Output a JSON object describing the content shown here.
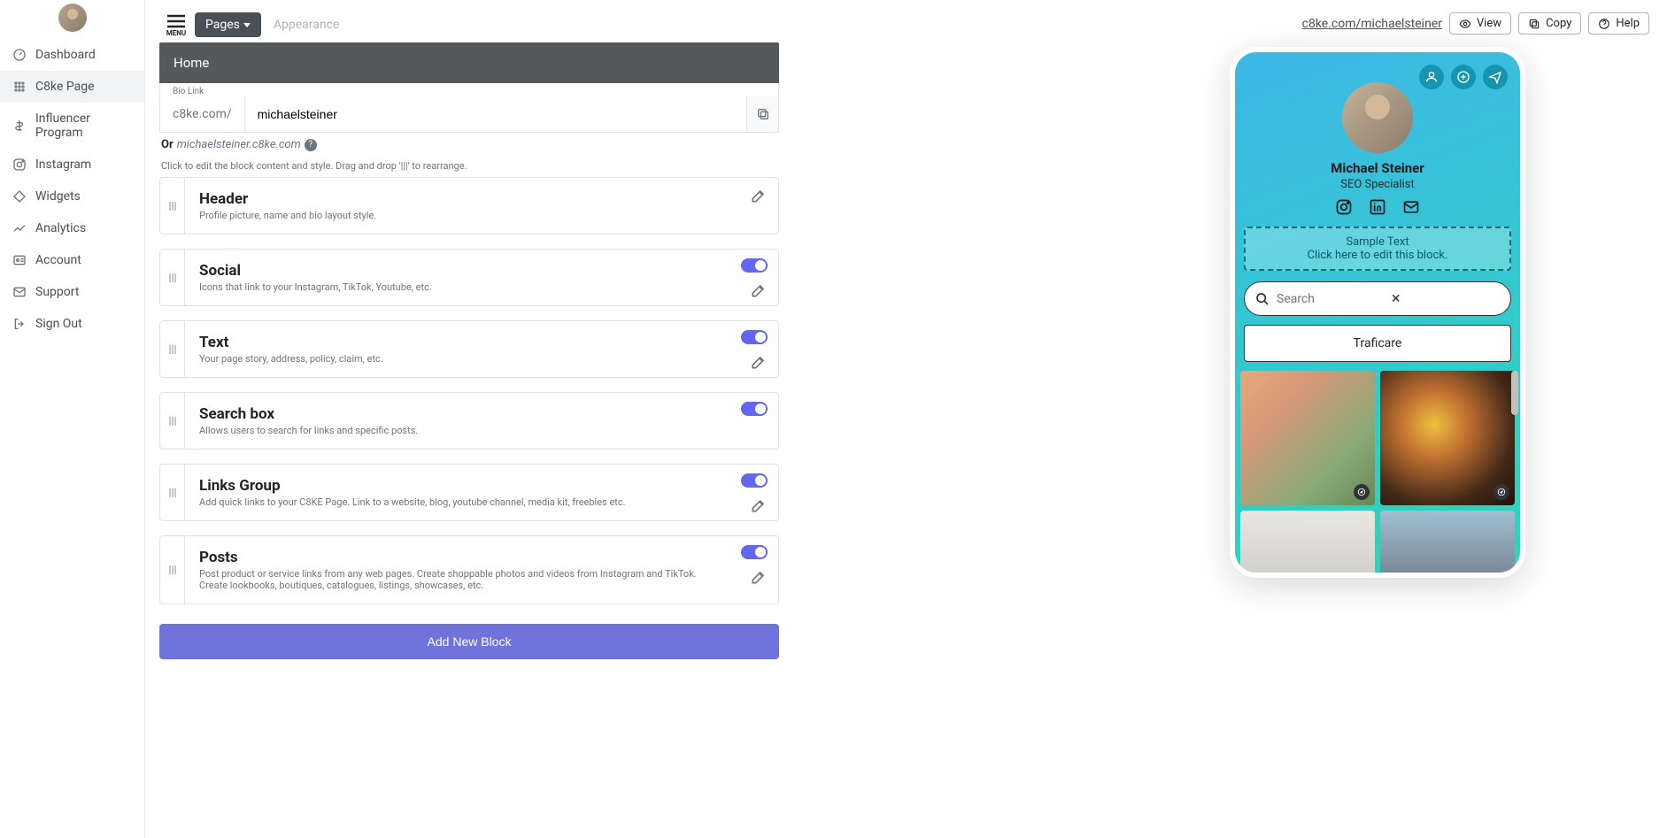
{
  "sidebar": {
    "items": [
      {
        "label": "Dashboard",
        "name": "dashboard"
      },
      {
        "label": "C8ke Page",
        "name": "c8ke-page",
        "active": true
      },
      {
        "label": "Influencer Program",
        "name": "influencer-program"
      },
      {
        "label": "Instagram",
        "name": "instagram"
      },
      {
        "label": "Widgets",
        "name": "widgets"
      },
      {
        "label": "Analytics",
        "name": "analytics"
      },
      {
        "label": "Account",
        "name": "account"
      },
      {
        "label": "Support",
        "name": "support"
      },
      {
        "label": "Sign Out",
        "name": "sign-out"
      }
    ]
  },
  "topbar": {
    "menu_label": "MENU",
    "tabs": [
      {
        "label": "Pages",
        "active": true
      },
      {
        "label": "Appearance",
        "active": false
      }
    ]
  },
  "page_bar": {
    "title": "Home"
  },
  "bio": {
    "label": "Bio Link",
    "prefix": "c8ke.com/",
    "value": "michaelsteiner",
    "or_prefix": "Or",
    "alt_domain": "michaelsteiner.c8ke.com"
  },
  "hint": "Click to edit the block content and style. Drag and drop '|||' to rearrange.",
  "blocks": [
    {
      "title": "Header",
      "desc": "Profile picture, name and bio layout style.",
      "toggle": false,
      "edit": true
    },
    {
      "title": "Social",
      "desc": "Icons that link to your Instagram, TikTok, Youtube, etc.",
      "toggle": true,
      "edit": true
    },
    {
      "title": "Text",
      "desc": "Your page story, address, policy, claim, etc.",
      "toggle": true,
      "edit": true
    },
    {
      "title": "Search box",
      "desc": "Allows users to search for links and specific posts.",
      "toggle": true,
      "edit": false
    },
    {
      "title": "Links Group",
      "desc": "Add quick links to your C8KE Page. Link to a website, blog, youtube channel, media kit, freebies etc.",
      "toggle": true,
      "edit": true
    },
    {
      "title": "Posts",
      "desc": "Post product or service links from any web pages. Create shoppable photos and videos from Instagram and TikTok. Create lookbooks, boutiques, catalogues, listings, showcases, etc.",
      "toggle": true,
      "edit": true
    }
  ],
  "add_button": "Add New Block",
  "right": {
    "url": "c8ke.com/michaelsteiner",
    "buttons": [
      {
        "label": "View",
        "icon": "eye"
      },
      {
        "label": "Copy",
        "icon": "copy"
      },
      {
        "label": "Help",
        "icon": "help"
      }
    ]
  },
  "preview": {
    "name": "Michael Steiner",
    "subtitle": "SEO Specialist",
    "sample_title": "Sample Text",
    "sample_sub": "Click here to edit this block.",
    "search_placeholder": "Search",
    "link_label": "Traficare"
  }
}
